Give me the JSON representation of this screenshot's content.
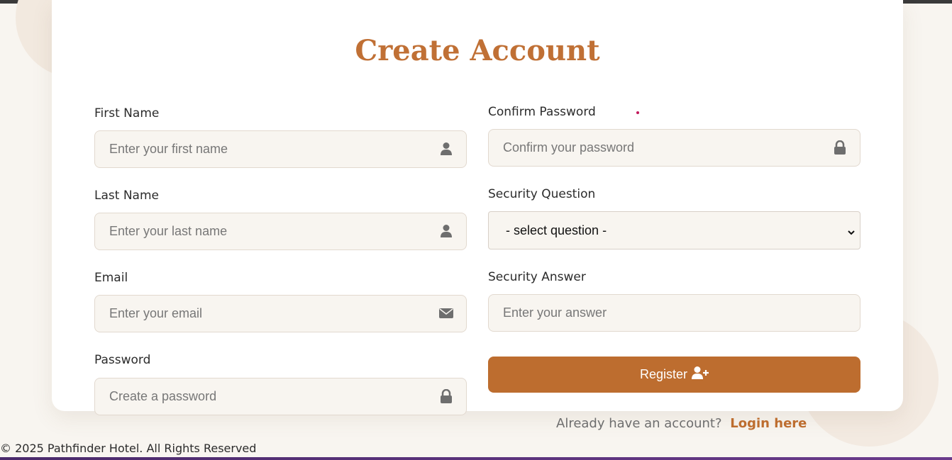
{
  "page": {
    "title": "Create Account"
  },
  "form": {
    "first_name": {
      "label": "First Name",
      "placeholder": "Enter your first name",
      "icon": "user-icon"
    },
    "last_name": {
      "label": "Last Name",
      "placeholder": "Enter your last name",
      "icon": "user-icon"
    },
    "email": {
      "label": "Email",
      "placeholder": "Enter your email",
      "icon": "envelope-icon"
    },
    "password": {
      "label": "Password",
      "placeholder": "Create a password",
      "icon": "lock-icon"
    },
    "confirm_password": {
      "label": "Confirm Password",
      "placeholder": "Confirm your password",
      "icon": "lock-icon"
    },
    "security_question": {
      "label": "Security Question",
      "selected": "- select question -"
    },
    "security_answer": {
      "label": "Security Answer",
      "placeholder": "Enter your answer"
    },
    "register_button": {
      "label": "Register",
      "icon": "user-plus-icon"
    }
  },
  "login_prompt": {
    "text": "Already have an account?",
    "link_label": "Login here"
  },
  "footer": {
    "text": "© 2025 Pathfinder Hotel. All Rights Reserved"
  },
  "colors": {
    "accent": "#bd6d2f",
    "title": "#c07035",
    "background": "#f8f5f0",
    "input_bg": "#f8f5f0"
  }
}
